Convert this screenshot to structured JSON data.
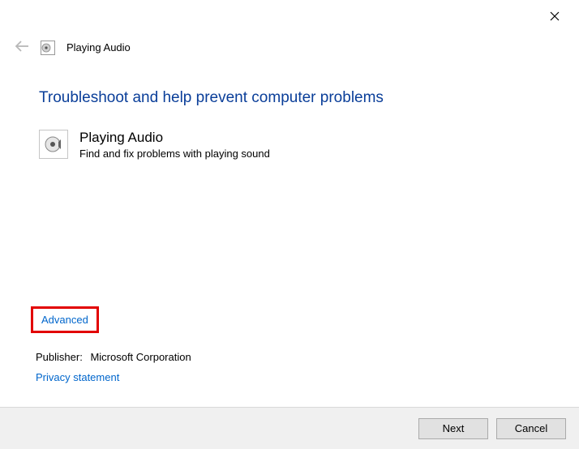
{
  "window": {
    "title": "Playing Audio"
  },
  "content": {
    "heading": "Troubleshoot and help prevent computer problems",
    "troubleshooter": {
      "title": "Playing Audio",
      "description": "Find and fix problems with playing sound"
    }
  },
  "links": {
    "advanced": "Advanced",
    "privacy": "Privacy statement"
  },
  "publisher": {
    "label": "Publisher:",
    "name": "Microsoft Corporation"
  },
  "buttons": {
    "next": "Next",
    "cancel": "Cancel"
  }
}
